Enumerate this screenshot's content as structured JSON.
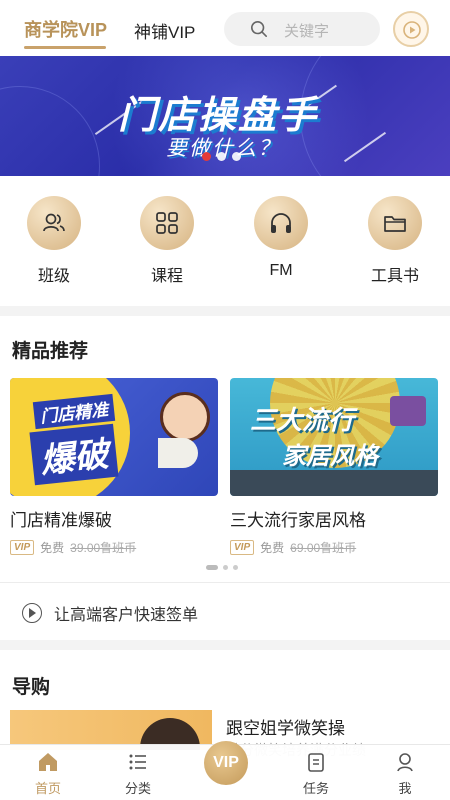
{
  "header": {
    "tab_active": "商学院VIP",
    "tab_other": "神铺VIP",
    "search_placeholder": "关键字"
  },
  "banner": {
    "title": "门店操盘手",
    "subtitle": "要做什么？"
  },
  "categories": [
    {
      "label": "班级",
      "icon": "people-icon"
    },
    {
      "label": "课程",
      "icon": "grid-icon"
    },
    {
      "label": "FM",
      "icon": "headphones-icon"
    },
    {
      "label": "工具书",
      "icon": "folder-icon"
    }
  ],
  "featured": {
    "title": "精品推荐",
    "cards": [
      {
        "title": "门店精准爆破",
        "image_text_top": "门店精准",
        "image_text_main": "爆破",
        "vip": "VIP",
        "free": "免费",
        "price": "39.00鲁班币"
      },
      {
        "title": "三大流行家居风格",
        "image_text_top": "三大流行",
        "image_text_main": "家居风格",
        "vip": "VIP",
        "free": "免费",
        "price": "69.00鲁班币"
      }
    ]
  },
  "audio": {
    "label": "让高端客户快速签单"
  },
  "guide": {
    "title": "导购",
    "item_title": "跟空姐学微笑操",
    "item_desc": "满分微笑培养满分业绩"
  },
  "nav": {
    "home": "首页",
    "category": "分类",
    "vip": "VIP",
    "task": "任务",
    "me": "我"
  },
  "colors": {
    "accent": "#c09a62",
    "banner": "#3a3fb8"
  }
}
